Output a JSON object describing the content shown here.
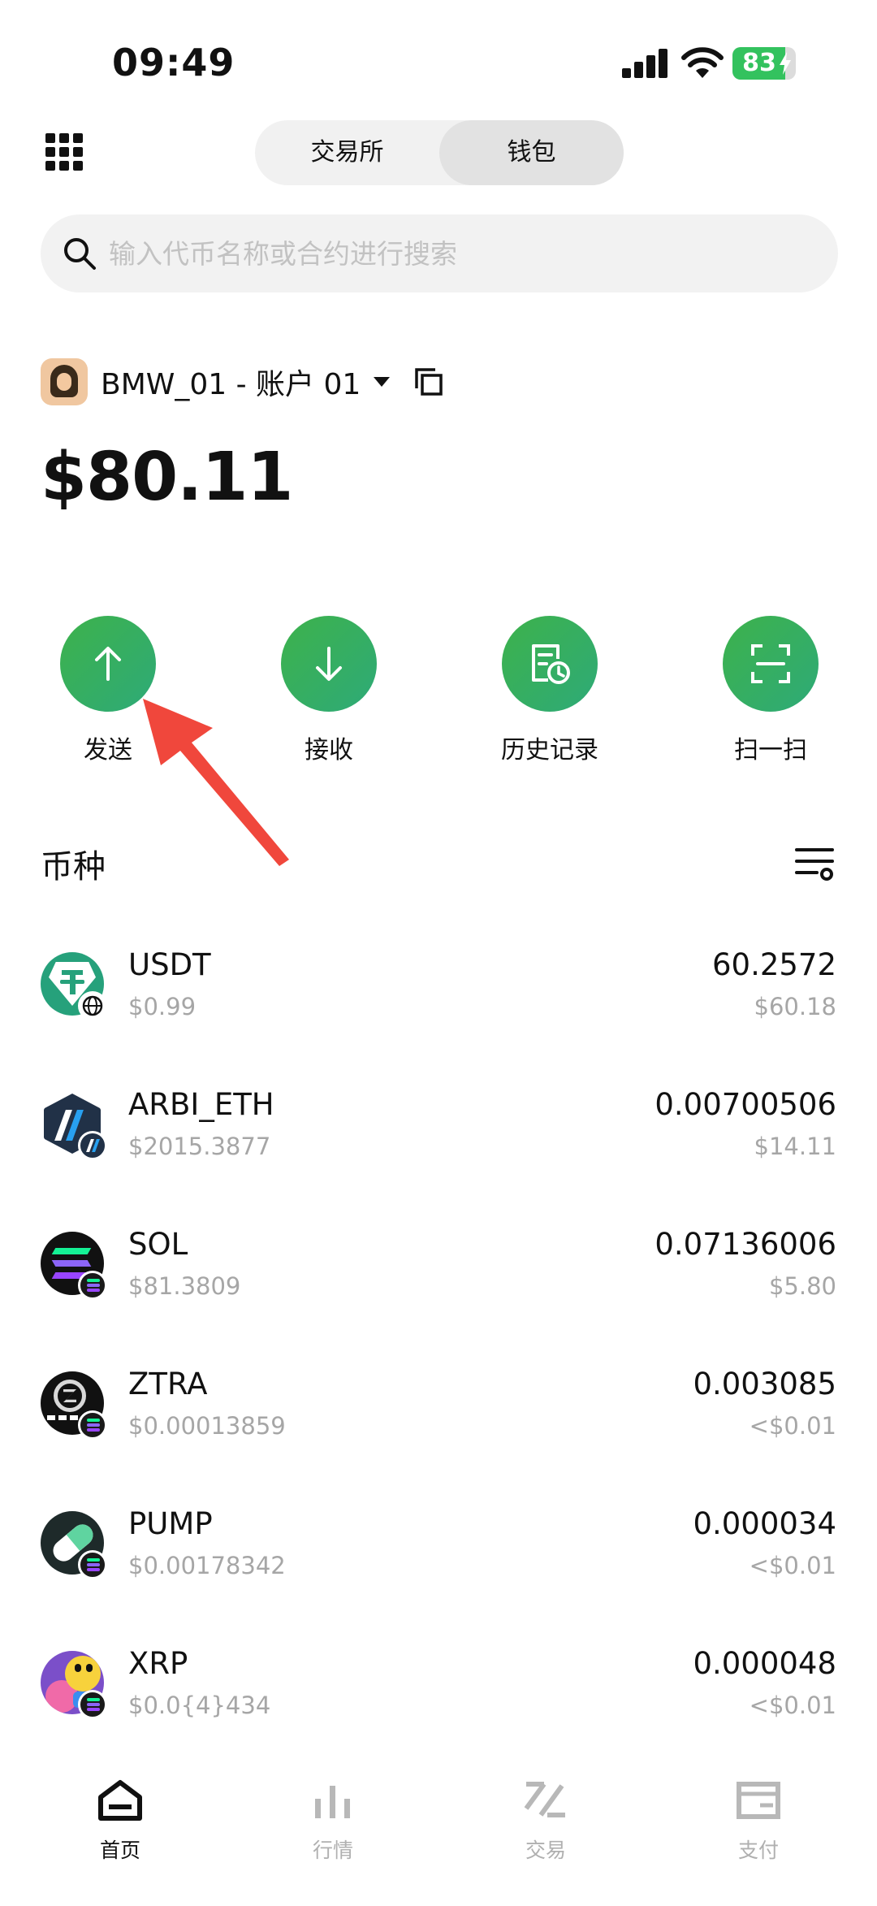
{
  "status_bar": {
    "time": "09:49",
    "battery_percent": "83",
    "battery_level": 0.83
  },
  "header": {
    "tabs": [
      {
        "label": "交易所",
        "active": false
      },
      {
        "label": "钱包",
        "active": true
      }
    ]
  },
  "search": {
    "placeholder": "输入代币名称或合约进行搜索"
  },
  "account": {
    "name": "BMW_01 - 账户 01",
    "balance": "$80.11"
  },
  "actions": [
    {
      "label": "发送",
      "icon": "arrow-up-icon"
    },
    {
      "label": "接收",
      "icon": "arrow-down-icon"
    },
    {
      "label": "历史记录",
      "icon": "history-icon"
    },
    {
      "label": "扫一扫",
      "icon": "scan-icon"
    }
  ],
  "tokens": {
    "title": "币种",
    "items": [
      {
        "symbol": "USDT",
        "price": "$0.99",
        "amount": "60.2572",
        "value": "$60.18"
      },
      {
        "symbol": "ARBI_ETH",
        "price": "$2015.3877",
        "amount": "0.00700506",
        "value": "$14.11"
      },
      {
        "symbol": "SOL",
        "price": "$81.3809",
        "amount": "0.07136006",
        "value": "$5.80"
      },
      {
        "symbol": "ZTRA",
        "price": "$0.00013859",
        "amount": "0.003085",
        "value": "<$0.01"
      },
      {
        "symbol": "PUMP",
        "price": "$0.00178342",
        "amount": "0.000034",
        "value": "<$0.01"
      },
      {
        "symbol": "XRP",
        "price": "$0.0{4}434",
        "amount": "0.000048",
        "value": "<$0.01"
      }
    ]
  },
  "bottom_nav": [
    {
      "label": "首页",
      "icon": "home-icon",
      "active": true
    },
    {
      "label": "行情",
      "icon": "market-icon",
      "active": false
    },
    {
      "label": "交易",
      "icon": "trade-icon",
      "active": false
    },
    {
      "label": "支付",
      "icon": "wallet-icon",
      "active": false
    }
  ],
  "colors": {
    "accent_green": "#3db24b",
    "annotation_red": "#f0473c",
    "muted_text": "#a6a6a6"
  }
}
